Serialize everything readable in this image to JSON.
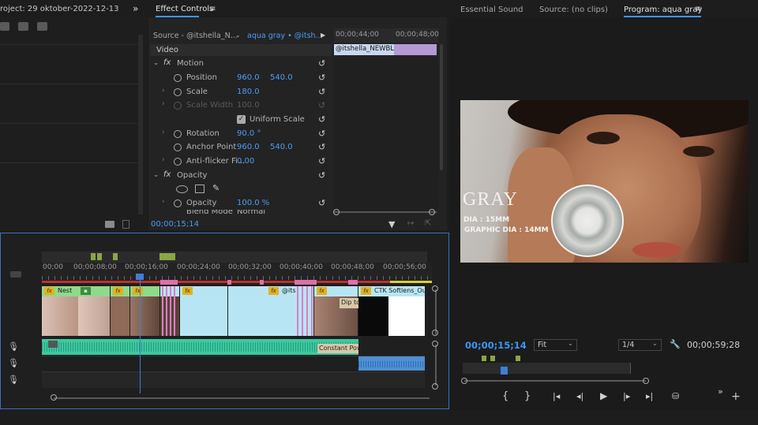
{
  "project_panel": {
    "title": "roject: 29 oktober-2022-12-13_17-1",
    "expand_label": "»"
  },
  "effect_controls": {
    "tab": "Effect Controls",
    "source_label": "Source - @itshella_N...",
    "sequence_label": "aqua gray • @itsh...",
    "mini_ruler_1": "00;00;44;00",
    "mini_ruler_2": "00;00;48;00",
    "mini_clip": "@itshella_NEWBL",
    "section_video": "Video",
    "motion": "Motion",
    "position_label": "Position",
    "position_x": "960.0",
    "position_y": "540.0",
    "scale_label": "Scale",
    "scale_value": "180.0",
    "scale_width_label": "Scale Width",
    "scale_width_value": "100.0",
    "uniform_scale": "Uniform Scale",
    "rotation_label": "Rotation",
    "rotation_value": "90.0 °",
    "anchor_label": "Anchor Point",
    "anchor_x": "960.0",
    "anchor_y": "540.0",
    "antiflicker_label": "Anti-flicker Fi...",
    "antiflicker_value": "0.00",
    "opacity_section": "Opacity",
    "opacity_label": "Opacity",
    "opacity_value": "100.0 %",
    "blend_label": "Blend Mode",
    "blend_value": "Normal",
    "timecode": "00;00;15;14"
  },
  "program_monitor": {
    "tabs": [
      "Essential Sound",
      "Source: (no clips)",
      "Program: aqua gray"
    ],
    "overlay_big": "GRAY",
    "overlay_line1": "DIA : 15MM",
    "overlay_line2": "GRAPHIC DIA : 14MM",
    "timecode": "00;00;15;14",
    "fit": "Fit",
    "resolution": "1/4",
    "duration": "00;00;59;28"
  },
  "timeline": {
    "ruler": [
      "00;00",
      "00;00;08;00",
      "00;00;16;00",
      "00;00;24;00",
      "00;00;32;00",
      "00;00;40;00",
      "00;00;48;00",
      "00;00;56;00"
    ],
    "clips": {
      "nest": "Nest",
      "its": "@its",
      "dip": "Dip to",
      "ctk": "CTK Softlens_Ou",
      "audio_effect": "Constant Powe"
    }
  },
  "colors": {
    "accent_blue": "#3d96f5",
    "clip_green": "#8fd98c",
    "clip_cyan": "#b8e5f3",
    "audio_green": "#3bc9a0",
    "marker_pink": "#d97fc7",
    "playhead": "#3d7fd6"
  }
}
